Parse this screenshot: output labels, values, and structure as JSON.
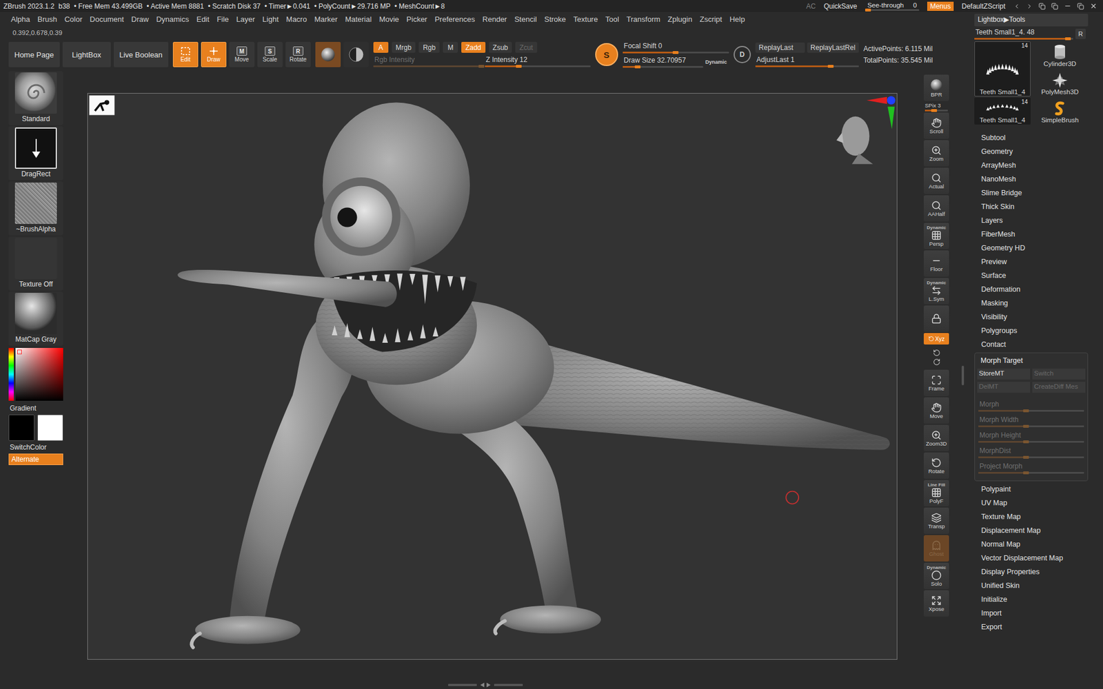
{
  "title_bar": {
    "app": "ZBrush 2023.1.2",
    "build": "b38",
    "stats": [
      "• Free Mem 43.499GB",
      "• Active Mem 8881",
      "• Scratch Disk 37",
      "• Timer►0.041",
      "• PolyCount►29.716 MP",
      "• MeshCount►8"
    ],
    "ac": "AC",
    "quicksave": "QuickSave",
    "see_through": {
      "label": "See-through",
      "value": "0",
      "level": 0
    },
    "menus": {
      "label": "Menus",
      "on": true
    },
    "script": "DefaultZScript"
  },
  "menu_bar": [
    "Alpha",
    "Brush",
    "Color",
    "Document",
    "Draw",
    "Dynamics",
    "Edit",
    "File",
    "Layer",
    "Light",
    "Macro",
    "Marker",
    "Material",
    "Movie",
    "Picker",
    "Preferences",
    "Render",
    "Stencil",
    "Stroke",
    "Texture",
    "Tool",
    "Transform",
    "Zplugin",
    "Zscript",
    "Help"
  ],
  "coordinates": "0.392,0.678,0.39",
  "shelf": {
    "nav": [
      "Home Page",
      "LightBox",
      "Live Boolean"
    ],
    "modes": [
      {
        "label": "Edit",
        "key": "",
        "selected": true
      },
      {
        "label": "Draw",
        "key": "",
        "selected": true
      },
      {
        "label": "Move",
        "key": "M",
        "selected": false
      },
      {
        "label": "Scale",
        "key": "S",
        "selected": false
      },
      {
        "label": "Rotate",
        "key": "R",
        "selected": false
      }
    ],
    "channels": [
      {
        "label": "A",
        "on": true,
        "disabled": false
      },
      {
        "label": "Mrgb",
        "on": false,
        "disabled": false
      },
      {
        "label": "Rgb",
        "on": false,
        "disabled": false
      },
      {
        "label": "M",
        "on": false,
        "disabled": false
      }
    ],
    "depth": [
      {
        "label": "Zadd",
        "on": true,
        "disabled": false
      },
      {
        "label": "Zsub",
        "on": false,
        "disabled": false
      },
      {
        "label": "Zcut",
        "on": false,
        "disabled": true
      }
    ],
    "rgb_intensity": {
      "text": "Rgb Intensity",
      "level": 1,
      "disabled": true
    },
    "z_intensity": {
      "text": "Z Intensity 12",
      "level": 0.32,
      "disabled": false
    },
    "sculptris": {
      "label": "S",
      "on": true
    },
    "focal_shift": {
      "text": "Focal Shift 0",
      "level": 0.5,
      "disabled": false
    },
    "draw_size": {
      "text": "Draw Size 32.70957",
      "level": 0.19,
      "disabled": false
    },
    "dynamic": "Dynamic",
    "dynamic_key": "D",
    "replay": [
      "ReplayLast",
      "ReplayLastRel"
    ],
    "adjust_last": {
      "text": "AdjustLast 1",
      "level": 0.73,
      "disabled": false
    },
    "points": [
      "ActivePoints: 6.115 Mil",
      "TotalPoints: 35.545 Mil"
    ]
  },
  "left_shelf": {
    "tiles": [
      {
        "label": "Standard",
        "kind": "brush"
      },
      {
        "label": "DragRect",
        "kind": "stroke"
      },
      {
        "label": "~BrushAlpha",
        "kind": "alpha"
      },
      {
        "label": "Texture Off",
        "kind": "texture"
      },
      {
        "label": "MatCap Gray",
        "kind": "material"
      }
    ],
    "gradient": "Gradient",
    "main_color": "#000000",
    "secondary_color": "#ffffff",
    "switch_color": "SwitchColor",
    "alternate": {
      "label": "Alternate",
      "on": true
    }
  },
  "right_toolbar": [
    {
      "label": "BPR",
      "caption": "",
      "kind": "button",
      "on": false,
      "disabled": false,
      "level": 0
    },
    {
      "label": "SPix 3",
      "caption": "",
      "kind": "slider",
      "on": false,
      "disabled": false,
      "level": 0.4
    },
    {
      "label": "Scroll",
      "caption": "",
      "kind": "button",
      "on": false,
      "disabled": false,
      "level": 0
    },
    {
      "label": "Zoom",
      "caption": "",
      "kind": "button",
      "on": false,
      "disabled": false,
      "level": 0
    },
    {
      "label": "Actual",
      "caption": "",
      "kind": "button",
      "on": false,
      "disabled": false,
      "level": 0
    },
    {
      "label": "AAHalf",
      "caption": "",
      "kind": "button",
      "on": false,
      "disabled": false,
      "level": 0
    },
    {
      "label": "Persp",
      "caption": "Dynamic",
      "kind": "button",
      "on": false,
      "disabled": false,
      "level": 0
    },
    {
      "label": "Floor",
      "caption": "",
      "kind": "button",
      "on": false,
      "disabled": false,
      "level": 0
    },
    {
      "label": "L.Sym",
      "caption": "Dynamic",
      "kind": "button",
      "on": false,
      "disabled": false,
      "level": 0
    },
    {
      "label": "",
      "caption": "",
      "kind": "button",
      "on": false,
      "disabled": false,
      "level": 0
    },
    {
      "label": "Xyz",
      "caption": "",
      "kind": "toggle",
      "on": true,
      "disabled": false,
      "level": 0
    },
    {
      "label": "",
      "caption": "",
      "kind": "pair",
      "on": false,
      "disabled": false,
      "level": 0
    },
    {
      "label": "Frame",
      "caption": "",
      "kind": "button",
      "on": false,
      "disabled": false,
      "level": 0
    },
    {
      "label": "Move",
      "caption": "",
      "kind": "button",
      "on": false,
      "disabled": false,
      "level": 0
    },
    {
      "label": "Zoom3D",
      "caption": "",
      "kind": "button",
      "on": false,
      "disabled": false,
      "level": 0
    },
    {
      "label": "Rotate",
      "caption": "",
      "kind": "button",
      "on": false,
      "disabled": false,
      "level": 0
    },
    {
      "label": "PolyF",
      "caption": "Line Fill",
      "kind": "button",
      "on": false,
      "disabled": false,
      "level": 0
    },
    {
      "label": "Transp",
      "caption": "",
      "kind": "button",
      "on": false,
      "disabled": false,
      "level": 0
    },
    {
      "label": "Ghost",
      "caption": "",
      "kind": "button",
      "on": true,
      "disabled": true,
      "level": 0
    },
    {
      "label": "Solo",
      "caption": "Dynamic",
      "kind": "button",
      "on": false,
      "disabled": false,
      "level": 0
    },
    {
      "label": "Xpose",
      "caption": "",
      "kind": "button",
      "on": false,
      "disabled": false,
      "level": 0
    }
  ],
  "tool_panel": {
    "header": "Lightbox▶Tools",
    "slider": {
      "text": "Teeth Small1_4. 48",
      "level": 0.95
    },
    "r_button": "R",
    "tools": [
      {
        "label": "Teeth Small1_4",
        "count": "14",
        "kind": "teeth",
        "selected": true
      },
      {
        "label": "Cylinder3D",
        "count": "",
        "kind": "cylinder",
        "selected": false
      },
      {
        "label": "PolyMesh3D",
        "count": "",
        "kind": "star",
        "selected": false
      },
      {
        "label": "Teeth Small1_4",
        "count": "14",
        "kind": "teeth-small",
        "selected": false
      },
      {
        "label": "SimpleBrush",
        "count": "",
        "kind": "brush",
        "selected": false
      }
    ],
    "palettes": [
      "Subtool",
      "Geometry",
      "ArrayMesh",
      "NanoMesh",
      "Slime Bridge",
      "Thick Skin",
      "Layers",
      "FiberMesh",
      "Geometry HD",
      "Preview",
      "Surface",
      "Deformation",
      "Masking",
      "Visibility",
      "Polygroups",
      "Contact"
    ],
    "morph_target": {
      "label": "Morph Target",
      "expanded": true,
      "buttons": [
        {
          "label": "StoreMT",
          "disabled": false
        },
        {
          "label": "Switch",
          "disabled": true
        },
        {
          "label": "DelMT",
          "disabled": true
        },
        {
          "label": "CreateDiff Mes",
          "disabled": true
        }
      ],
      "sliders": [
        {
          "label": "Morph",
          "level": 0.45,
          "disabled": true
        },
        {
          "label": "Morph Width",
          "level": 0.45,
          "disabled": true
        },
        {
          "label": "Morph Height",
          "level": 0.45,
          "disabled": true
        },
        {
          "label": "MorphDist",
          "level": 0.45,
          "disabled": true
        },
        {
          "label": "Project Morph",
          "level": 0.45,
          "disabled": true
        }
      ]
    },
    "palettes_after": [
      "Polypaint",
      "UV Map",
      "Texture Map",
      "Displacement Map",
      "Normal Map",
      "Vector Displacement Map",
      "Display Properties",
      "Unified Skin",
      "Initialize",
      "Import",
      "Export"
    ]
  }
}
